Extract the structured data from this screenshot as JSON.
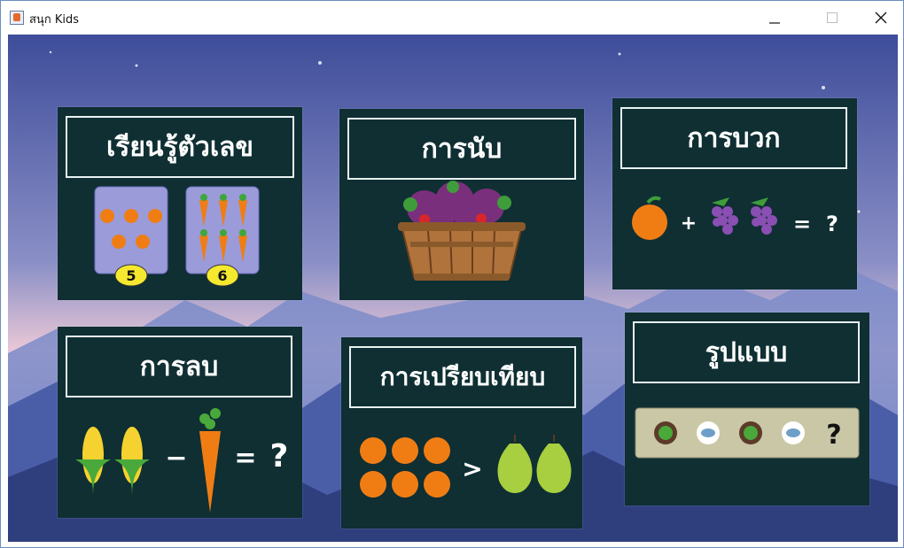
{
  "window": {
    "title": "สนุก Kids"
  },
  "cards": [
    {
      "label": "เรียนรู้ตัวเลข",
      "badges": [
        "5",
        "6"
      ]
    },
    {
      "label": "การนับ"
    },
    {
      "label": "การบวก",
      "plus": "+",
      "equals": "=",
      "question": "?"
    },
    {
      "label": "การลบ",
      "minus": "−",
      "equals": "=",
      "question": "?"
    },
    {
      "label": "การเปรียบเทียบ",
      "greater": ">"
    },
    {
      "label": "รูปแบบ",
      "question": "?"
    }
  ],
  "colors": {
    "card": "#0f2f33",
    "border": "#e9f2f2",
    "badge": "#f5e930"
  }
}
